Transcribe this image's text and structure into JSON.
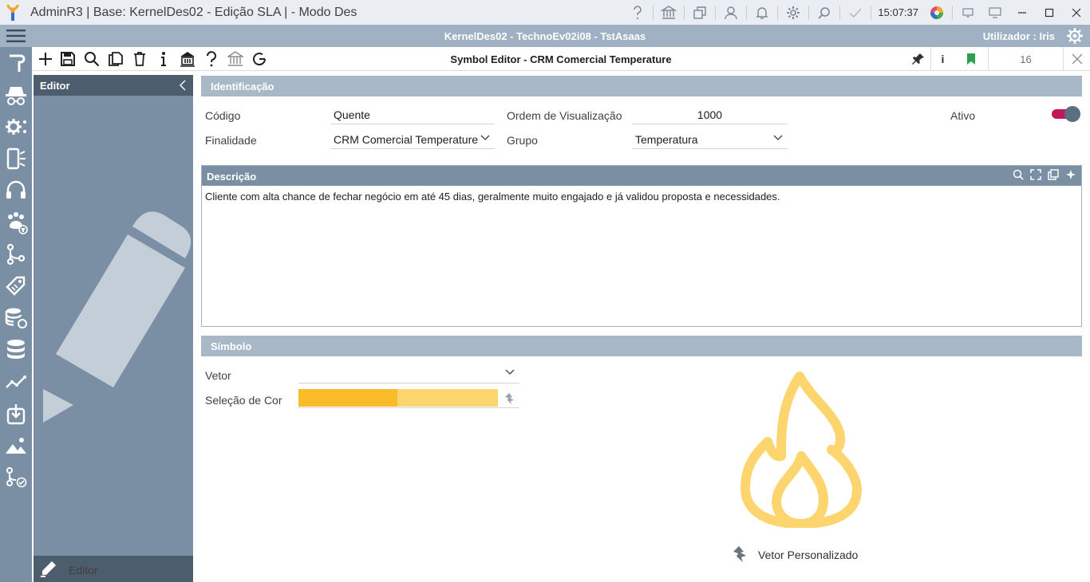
{
  "titlebar": {
    "title": "AdminR3 | Base: KernelDes02 - Edição SLA | - Modo Des",
    "clock": "15:07:37",
    "icons": [
      "help-icon",
      "bank-icon",
      "windows-icon",
      "user-icon",
      "bell-icon",
      "gear-icon",
      "search-chat-icon",
      "check-icon"
    ]
  },
  "navbar": {
    "center": "KernelDes02 - TechnoEv02i08 - TstAsaas",
    "user": "Utilizador : Iris"
  },
  "leftbar": {
    "icons": [
      "hook-icon",
      "incognito-icon",
      "gear-network-icon",
      "mobile-network-icon",
      "headset-icon",
      "paw-filter-icon",
      "flow-icon",
      "tags-icon",
      "database-refresh-icon",
      "database-icon",
      "chart-line-icon",
      "upload-icon",
      "image-icon",
      "flow-check-icon"
    ]
  },
  "toolbar": {
    "title": "Symbol Editor - CRM Comercial Temperature",
    "counter": "16",
    "info": "i"
  },
  "editor_panel": {
    "header": "Editor",
    "footer": "Editor"
  },
  "identificacao": {
    "header": "Identificação",
    "codigo_label": "Código",
    "codigo_value": "Quente",
    "ordem_label": "Ordem de Visualização",
    "ordem_value": "1000",
    "ativo_label": "Ativo",
    "ativo_on": true,
    "finalidade_label": "Finalidade",
    "finalidade_value": "CRM Comercial Temperature",
    "grupo_label": "Grupo",
    "grupo_value": "Temperatura"
  },
  "descricao": {
    "header": "Descrição",
    "text": "Cliente com alta chance de fechar negócio em até 45 dias, geralmente muito engajado e já validou proposta e necessidades."
  },
  "simbolo": {
    "header": "Símbolo",
    "vetor_label": "Vetor",
    "vetor_value": "",
    "cor_label": "Seleção de Cor",
    "color_primary": "#fbbc2a",
    "color_secondary": "#fcd56f",
    "preview_color": "#fcd56f",
    "preview_label": "Vetor Personalizado"
  },
  "colors": {
    "navbar": "#9fb1c2",
    "sidebar": "#7a8fa3",
    "panel_head": "#4c5d6d",
    "section_head": "#a8b8c7",
    "toggle_track": "#c2185b",
    "toggle_knob": "#5b6f83"
  }
}
